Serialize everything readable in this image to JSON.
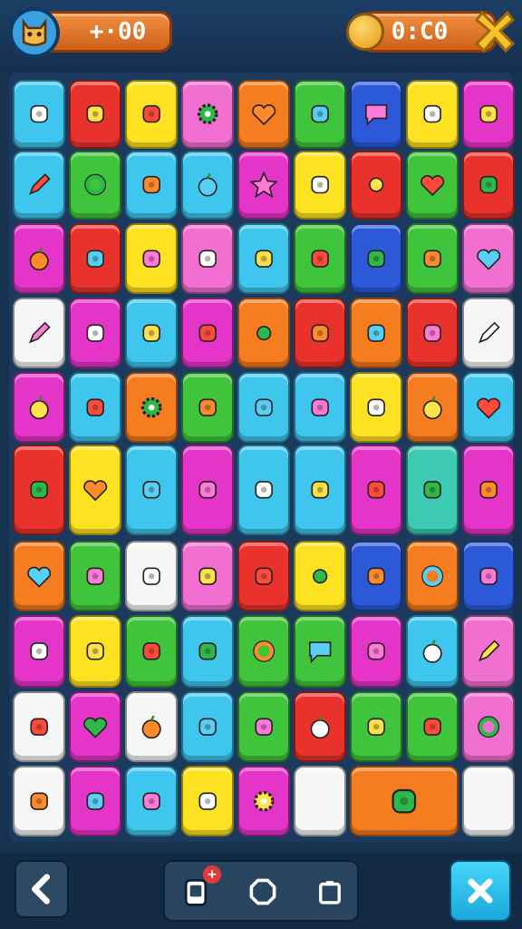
{
  "hud": {
    "left_counter": "+·00",
    "right_counter": "0:C0"
  },
  "colors": {
    "red": "#e8322b",
    "orange": "#f57c1f",
    "yellow": "#fde222",
    "green": "#3fc43c",
    "cyan": "#3fc6ee",
    "blue": "#2b59d8",
    "magenta": "#e435c8",
    "pink": "#f06fd0",
    "white": "#f6f6f6",
    "teal": "#3ccab2"
  },
  "board": {
    "rows": [
      [
        [
          "cyan",
          "arch-icon"
        ],
        [
          "red",
          "leaf-icon"
        ],
        [
          "yellow",
          "bag-icon"
        ],
        [
          "pink",
          "gear-icon"
        ],
        [
          "orange",
          "heart-icon"
        ],
        [
          "green",
          "bottle-icon"
        ],
        [
          "blue",
          "speech-bubble-icon"
        ],
        [
          "yellow",
          "snail-icon"
        ],
        [
          "magenta",
          "lemon-icon"
        ]
      ],
      [
        [
          "cyan",
          "pencil-icon"
        ],
        [
          "green",
          "ring-icon"
        ],
        [
          "cyan",
          "gem-icon"
        ],
        [
          "cyan",
          "apple-icon"
        ],
        [
          "magenta",
          "star-icon"
        ],
        [
          "yellow",
          "target-icon"
        ],
        [
          "red",
          "dot-icon"
        ],
        [
          "green",
          "heart-icon"
        ],
        [
          "red",
          "ball-icon"
        ]
      ],
      [
        [
          "magenta",
          "apple-icon"
        ],
        [
          "red",
          "gate-icon"
        ],
        [
          "yellow",
          "berries-icon"
        ],
        [
          "pink",
          "cherry-icon"
        ],
        [
          "cyan",
          "mirror-icon"
        ],
        [
          "green",
          "card-icon"
        ],
        [
          "blue",
          "lock-icon"
        ],
        [
          "green",
          "flag-icon"
        ],
        [
          "pink",
          "heart-icon"
        ]
      ],
      [
        [
          "white",
          "pencil-icon"
        ],
        [
          "magenta",
          "puzzle-icon"
        ],
        [
          "cyan",
          "egg-icon"
        ],
        [
          "magenta",
          "donut-icon"
        ],
        [
          "orange",
          "dot-icon"
        ],
        [
          "red",
          "battery-icon"
        ],
        [
          "orange",
          "ruler-icon"
        ],
        [
          "red",
          "yarn-ball-icon"
        ],
        [
          "white",
          "pencil-icon"
        ]
      ],
      [
        [
          "magenta",
          "apple-icon"
        ],
        [
          "cyan",
          "crayon-icon"
        ],
        [
          "orange",
          "gear-icon"
        ],
        [
          "green",
          "leaf-icon"
        ],
        [
          "cyan",
          "cookie-icon"
        ],
        [
          "cyan",
          "hook-icon"
        ],
        [
          "yellow",
          "lime-icon"
        ],
        [
          "orange",
          "apple-icon"
        ],
        [
          "cyan",
          "heart-icon"
        ]
      ],
      [
        [
          "red",
          "ice-cream-icon"
        ],
        [
          "yellow",
          "heart-icon"
        ],
        [
          "cyan",
          "splat-icon"
        ],
        [
          "magenta",
          "ice-cream-icon"
        ],
        [
          "cyan",
          "ghost-icon"
        ],
        [
          "cyan",
          "brush-icon"
        ],
        [
          "magenta",
          "lemon-icon"
        ],
        [
          "teal",
          "virus-icon"
        ],
        [
          "magenta",
          "question-icon"
        ]
      ],
      [
        [
          "orange",
          "heart-icon"
        ],
        [
          "green",
          "bean-icon"
        ],
        [
          "white",
          "robot-icon"
        ],
        [
          "pink",
          "tablet-icon"
        ],
        [
          "red",
          "lightning-icon"
        ],
        [
          "yellow",
          "dot-icon"
        ],
        [
          "blue",
          "crayon-icon"
        ],
        [
          "orange",
          "ring-icon"
        ],
        [
          "blue",
          "drop-icon"
        ]
      ],
      [
        [
          "magenta",
          "flag-icon"
        ],
        [
          "yellow",
          "crayon-icon"
        ],
        [
          "green",
          "torch-icon"
        ],
        [
          "cyan",
          "no-sign-icon"
        ],
        [
          "green",
          "ring-icon"
        ],
        [
          "green",
          "speech-bubble-icon"
        ],
        [
          "magenta",
          "cow-icon"
        ],
        [
          "cyan",
          "apple-icon"
        ],
        [
          "pink",
          "pencil-icon"
        ]
      ],
      [
        [
          "white",
          "sun-icon"
        ],
        [
          "magenta",
          "heart-icon"
        ],
        [
          "white",
          "apple-icon"
        ],
        [
          "cyan",
          "ball-icon"
        ],
        [
          "green",
          "ball-icon"
        ],
        [
          "red",
          "apple-icon"
        ],
        [
          "green",
          "square-icon"
        ],
        [
          "green",
          "diamond-icon"
        ],
        [
          "pink",
          "ring-icon"
        ]
      ],
      [
        [
          "white",
          "lollipop-icon"
        ],
        [
          "magenta",
          "sun-icon"
        ],
        [
          "cyan",
          "moon-icon"
        ],
        [
          "yellow",
          "camera-icon"
        ],
        [
          "magenta",
          "gear-icon"
        ],
        [
          "white",
          "blank-icon"
        ],
        [
          "orange",
          "play-flag-icon",
          2
        ],
        [
          "white",
          "blank-icon"
        ]
      ]
    ]
  },
  "bottom": {
    "badge": "+"
  }
}
